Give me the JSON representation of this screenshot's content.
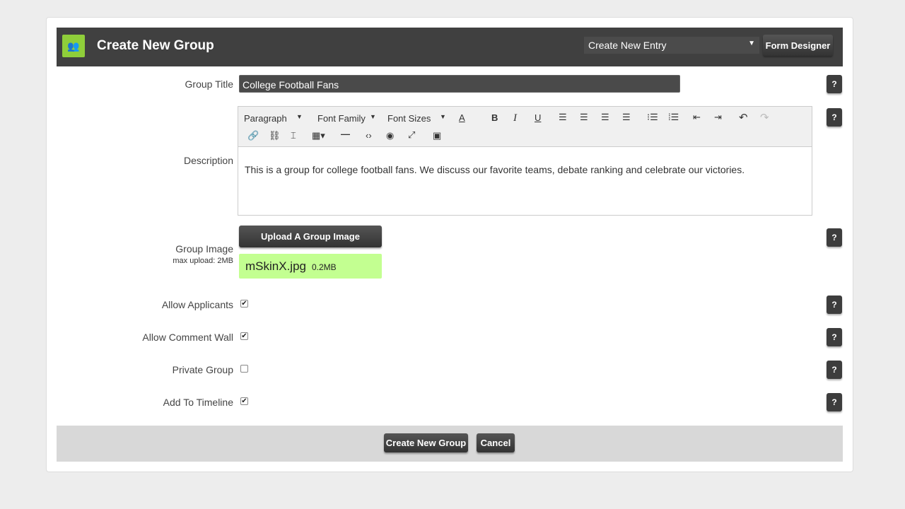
{
  "header": {
    "title": "Create New Group",
    "entry_select": "Create New Entry",
    "form_designer": "Form Designer"
  },
  "fields": {
    "group_title": {
      "label": "Group Title",
      "value": "College Football Fans"
    },
    "description": {
      "label": "Description",
      "value": "This is a group for college football fans. We discuss our favorite teams, debate ranking and celebrate our victories.",
      "toolbar": {
        "paragraph": "Paragraph",
        "font_family": "Font Family",
        "font_sizes": "Font Sizes"
      }
    },
    "group_image": {
      "label": "Group Image",
      "hint": "max upload: 2MB",
      "upload_button": "Upload A Group Image",
      "file_name": "mSkinX.jpg",
      "file_size": "0.2MB"
    },
    "allow_applicants": {
      "label": "Allow Applicants",
      "checked": true
    },
    "allow_comment_wall": {
      "label": "Allow Comment Wall",
      "checked": true
    },
    "private_group": {
      "label": "Private Group",
      "checked": false
    },
    "add_to_timeline": {
      "label": "Add To Timeline",
      "checked": true
    }
  },
  "help_label": "?",
  "footer": {
    "create": "Create New Group",
    "cancel": "Cancel"
  }
}
